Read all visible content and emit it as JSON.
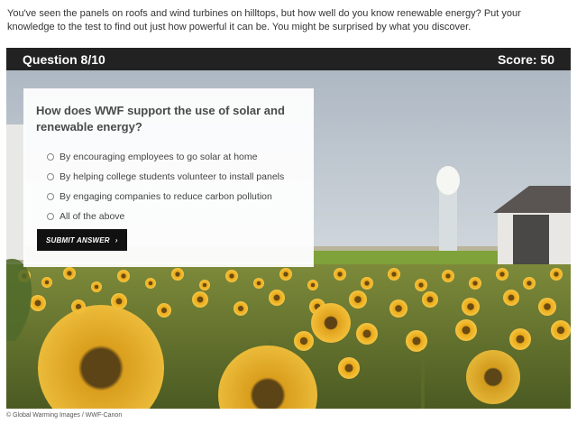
{
  "intro_text": "You've seen the panels on roofs and wind turbines on hilltops, but how well do you know renewable energy? Put your knowledge to the test to find out just how powerful it can be. You might be surprised by what you discover.",
  "quiz": {
    "question_counter": "Question 8/10",
    "score": "Score: 50",
    "question": "How does WWF support the use of solar and renewable energy?",
    "options": [
      "By encouraging employees to go solar at home",
      "By helping college students volunteer to install panels",
      "By engaging companies to reduce carbon pollution",
      "All of the above"
    ],
    "submit_label": "SUBMIT ANSWER",
    "submit_icon": "chevron-right-icon"
  },
  "caption": "© Global Warming Images / WWF-Canon"
}
